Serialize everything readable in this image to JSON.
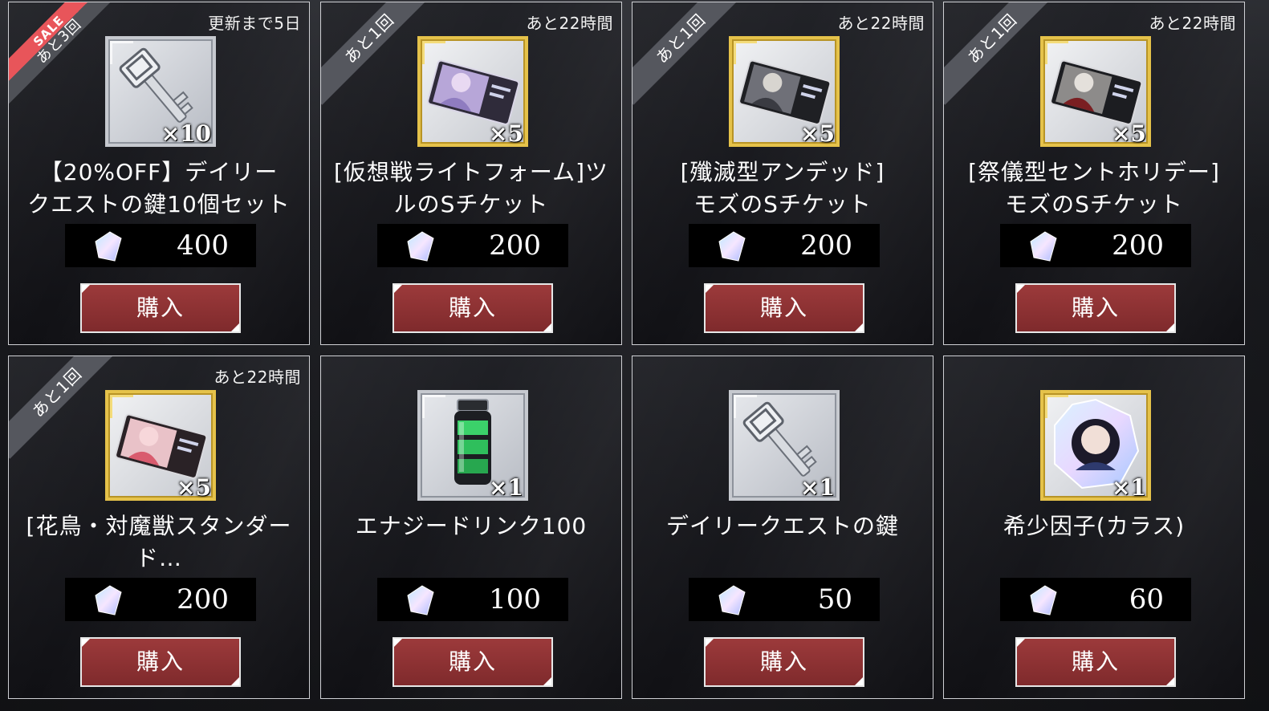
{
  "shop": {
    "buy_label": "購入",
    "cards": [
      {
        "ribbon_sale": "SALE",
        "ribbon": "あと3回",
        "timer": "更新まで5日",
        "name_lines": [
          "【20%OFF】デイリー",
          "クエストの鍵10個セット"
        ],
        "icon": "daily-quest-key-icon",
        "frame": "silver",
        "quantity": "×10",
        "price": "400"
      },
      {
        "ribbon": "あと1回",
        "timer": "あと22時間",
        "name_lines": [
          "[仮想戦ライトフォーム]ツ",
          "ルのSチケット"
        ],
        "icon": "s-ticket-icon",
        "frame": "gold",
        "quantity": "×5",
        "price": "200"
      },
      {
        "ribbon": "あと1回",
        "timer": "あと22時間",
        "name_lines": [
          "[殲滅型アンデッド]",
          "モズのSチケット"
        ],
        "icon": "s-ticket-icon",
        "frame": "gold",
        "quantity": "×5",
        "price": "200"
      },
      {
        "ribbon": "あと1回",
        "timer": "あと22時間",
        "name_lines": [
          "[祭儀型セントホリデー]",
          "モズのSチケット"
        ],
        "icon": "s-ticket-icon",
        "frame": "gold",
        "quantity": "×5",
        "price": "200"
      },
      {
        "ribbon": "あと1回",
        "timer": "あと22時間",
        "name_lines": [
          "[花鳥・対魔獣スタンダー",
          "ド…"
        ],
        "icon": "s-ticket-icon",
        "frame": "gold",
        "quantity": "×5",
        "price": "200"
      },
      {
        "ribbon": "",
        "timer": "",
        "name_lines": [
          "エナジードリンク100",
          ""
        ],
        "icon": "energy-drink-icon",
        "frame": "silver",
        "quantity": "×1",
        "price": "100"
      },
      {
        "ribbon": "",
        "timer": "",
        "name_lines": [
          "デイリークエストの鍵",
          ""
        ],
        "icon": "daily-quest-key-icon",
        "frame": "silver",
        "quantity": "×1",
        "price": "50"
      },
      {
        "ribbon": "",
        "timer": "",
        "name_lines": [
          "希少因子(カラス)",
          ""
        ],
        "icon": "rare-factor-crystal-icon",
        "frame": "gold",
        "quantity": "×1",
        "price": "60"
      }
    ]
  },
  "colors": {
    "buy_button": "#8e3334",
    "gold_frame": "#e5c24a",
    "silver_frame": "#c6c9cf",
    "sale_ribbon": "#e8555a",
    "ribbon": "#55575e"
  }
}
